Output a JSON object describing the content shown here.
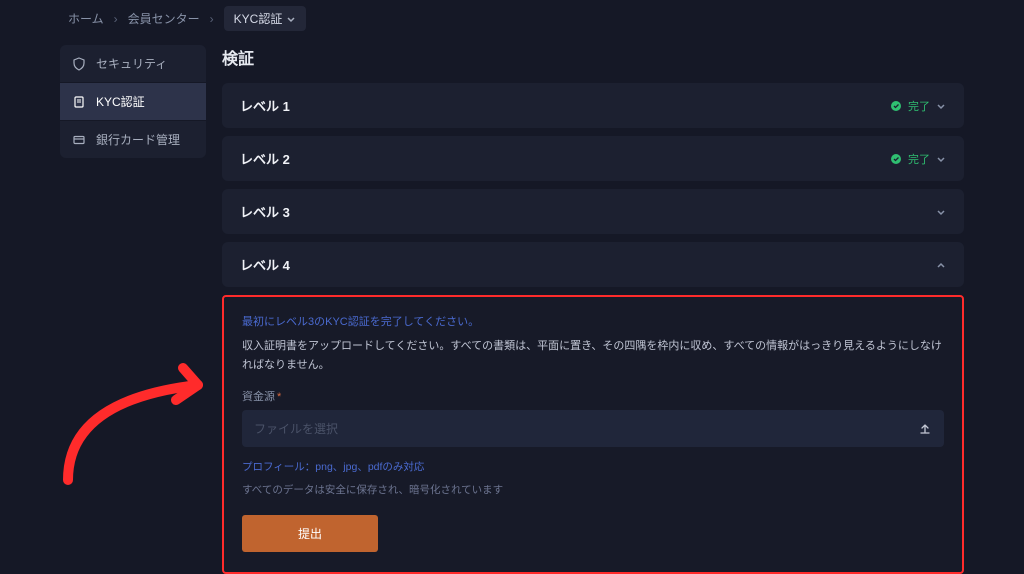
{
  "breadcrumb": {
    "home": "ホーム",
    "center": "会員センター",
    "current": "KYC認証"
  },
  "sidebar": {
    "items": [
      {
        "label": "セキュリティ",
        "icon": "shield-icon",
        "active": false
      },
      {
        "label": "KYC認証",
        "icon": "document-icon",
        "active": true
      },
      {
        "label": "銀行カード管理",
        "icon": "card-icon",
        "active": false
      }
    ]
  },
  "page": {
    "title": "検証"
  },
  "levels": [
    {
      "label": "レベル 1",
      "status": "完了",
      "done": true
    },
    {
      "label": "レベル 2",
      "status": "完了",
      "done": true
    },
    {
      "label": "レベル 3",
      "status": "",
      "done": false
    },
    {
      "label": "レベル 4",
      "status": "",
      "done": false,
      "expanded": true
    }
  ],
  "form": {
    "warning": "最初にレベル3のKYC認証を完了してください。",
    "instruction": "収入証明書をアップロードしてください。すべての書類は、平面に置き、その四隅を枠内に収め、すべての情報がはっきり見えるようにしなければなりません。",
    "field_label": "資金源",
    "file_placeholder": "ファイルを選択",
    "hint": "プロフィール：png、jpg、pdfのみ対応",
    "secure_note": "すべてのデータは安全に保存され、暗号化されています",
    "submit_label": "提出"
  }
}
